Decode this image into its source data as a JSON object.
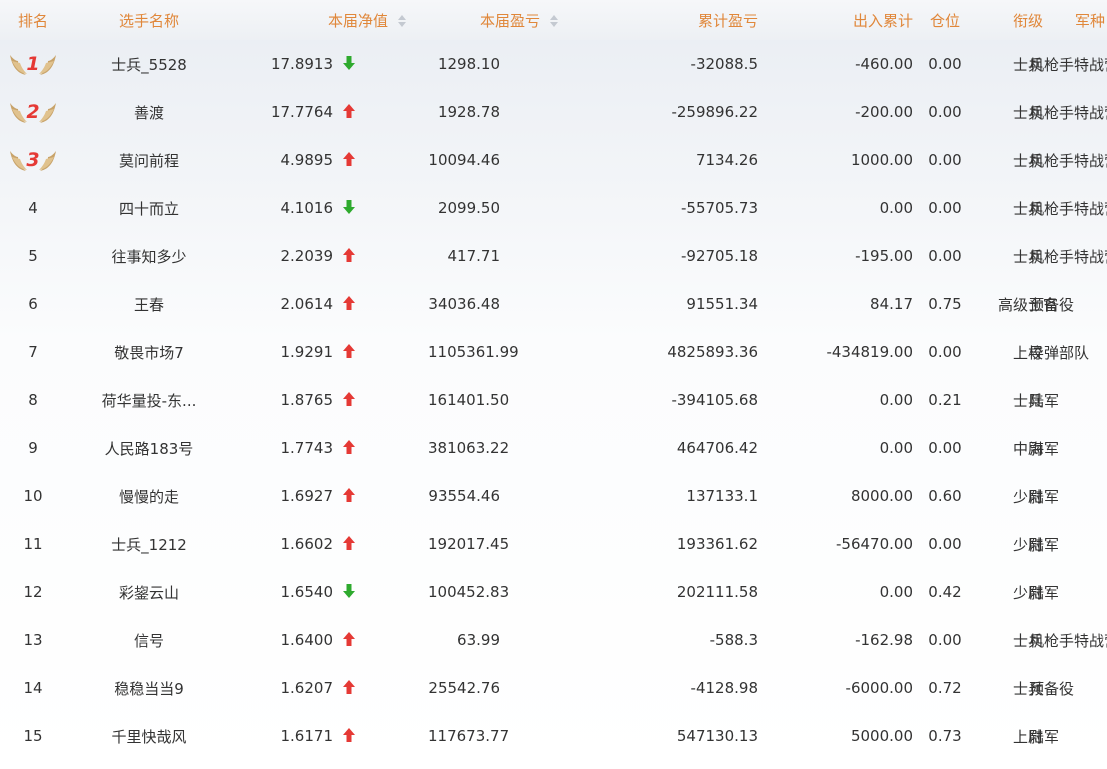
{
  "headers": {
    "rank": "排名",
    "name": "选手名称",
    "nav": "本届净值",
    "pnl": "本届盈亏",
    "cum": "累计盈亏",
    "inout": "出入累计",
    "position": "仓位",
    "title": "衔级",
    "branch": "军种"
  },
  "colors": {
    "header_text": "#e0873a",
    "up": "#e53935",
    "down": "#2eaa2e",
    "medal_number": "#e53935"
  },
  "rows": [
    {
      "rank": "1",
      "name": "士兵_5528",
      "nav": "17.8913",
      "trend": "down",
      "pnl": "1298.10",
      "cum": "-32088.5",
      "inout": "-460.00",
      "position": "0.00",
      "title": "士兵",
      "branch": "机枪手特战营"
    },
    {
      "rank": "2",
      "name": "善渡",
      "nav": "17.7764",
      "trend": "up",
      "pnl": "1928.78",
      "cum": "-259896.22",
      "inout": "-200.00",
      "position": "0.00",
      "title": "士兵",
      "branch": "机枪手特战营"
    },
    {
      "rank": "3",
      "name": "莫问前程",
      "nav": "4.9895",
      "trend": "up",
      "pnl": "10094.46",
      "cum": "7134.26",
      "inout": "1000.00",
      "position": "0.00",
      "title": "士兵",
      "branch": "机枪手特战营"
    },
    {
      "rank": "4",
      "name": "四十而立",
      "nav": "4.1016",
      "trend": "down",
      "pnl": "2099.50",
      "cum": "-55705.73",
      "inout": "0.00",
      "position": "0.00",
      "title": "士兵",
      "branch": "机枪手特战营"
    },
    {
      "rank": "5",
      "name": "往事知多少",
      "nav": "2.2039",
      "trend": "up",
      "pnl": "417.71",
      "cum": "-92705.18",
      "inout": "-195.00",
      "position": "0.00",
      "title": "士兵",
      "branch": "机枪手特战营"
    },
    {
      "rank": "6",
      "name": "王春",
      "nav": "2.0614",
      "trend": "up",
      "pnl": "34036.48",
      "cum": "91551.34",
      "inout": "84.17",
      "position": "0.75",
      "title": "高级士官",
      "branch": "预备役"
    },
    {
      "rank": "7",
      "name": "敬畏市场7",
      "nav": "1.9291",
      "trend": "up",
      "pnl": "1105361.99",
      "cum": "4825893.36",
      "inout": "-434819.00",
      "position": "0.00",
      "title": "上校",
      "branch": "导弹部队"
    },
    {
      "rank": "8",
      "name": "荷华量投-东...",
      "nav": "1.8765",
      "trend": "up",
      "pnl": "161401.50",
      "cum": "-394105.68",
      "inout": "0.00",
      "position": "0.21",
      "title": "士兵",
      "branch": "陆军"
    },
    {
      "rank": "9",
      "name": "人民路183号",
      "nav": "1.7743",
      "trend": "up",
      "pnl": "381063.22",
      "cum": "464706.42",
      "inout": "0.00",
      "position": "0.00",
      "title": "中尉",
      "branch": "海军"
    },
    {
      "rank": "10",
      "name": "慢慢的走",
      "nav": "1.6927",
      "trend": "up",
      "pnl": "93554.46",
      "cum": "137133.1",
      "inout": "8000.00",
      "position": "0.60",
      "title": "少尉",
      "branch": "陆军"
    },
    {
      "rank": "11",
      "name": "士兵_1212",
      "nav": "1.6602",
      "trend": "up",
      "pnl": "192017.45",
      "cum": "193361.62",
      "inout": "-56470.00",
      "position": "0.00",
      "title": "少尉",
      "branch": "陆军"
    },
    {
      "rank": "12",
      "name": "彩鋆云山",
      "nav": "1.6540",
      "trend": "down",
      "pnl": "100452.83",
      "cum": "202111.58",
      "inout": "0.00",
      "position": "0.42",
      "title": "少尉",
      "branch": "陆军"
    },
    {
      "rank": "13",
      "name": "信号",
      "nav": "1.6400",
      "trend": "up",
      "pnl": "63.99",
      "cum": "-588.3",
      "inout": "-162.98",
      "position": "0.00",
      "title": "士兵",
      "branch": "机枪手特战营"
    },
    {
      "rank": "14",
      "name": "稳稳当当9",
      "nav": "1.6207",
      "trend": "up",
      "pnl": "25542.76",
      "cum": "-4128.98",
      "inout": "-6000.00",
      "position": "0.72",
      "title": "士兵",
      "branch": "预备役"
    },
    {
      "rank": "15",
      "name": "千里快哉风",
      "nav": "1.6171",
      "trend": "up",
      "pnl": "117673.77",
      "cum": "547130.13",
      "inout": "5000.00",
      "position": "0.73",
      "title": "上尉",
      "branch": "陆军"
    }
  ]
}
